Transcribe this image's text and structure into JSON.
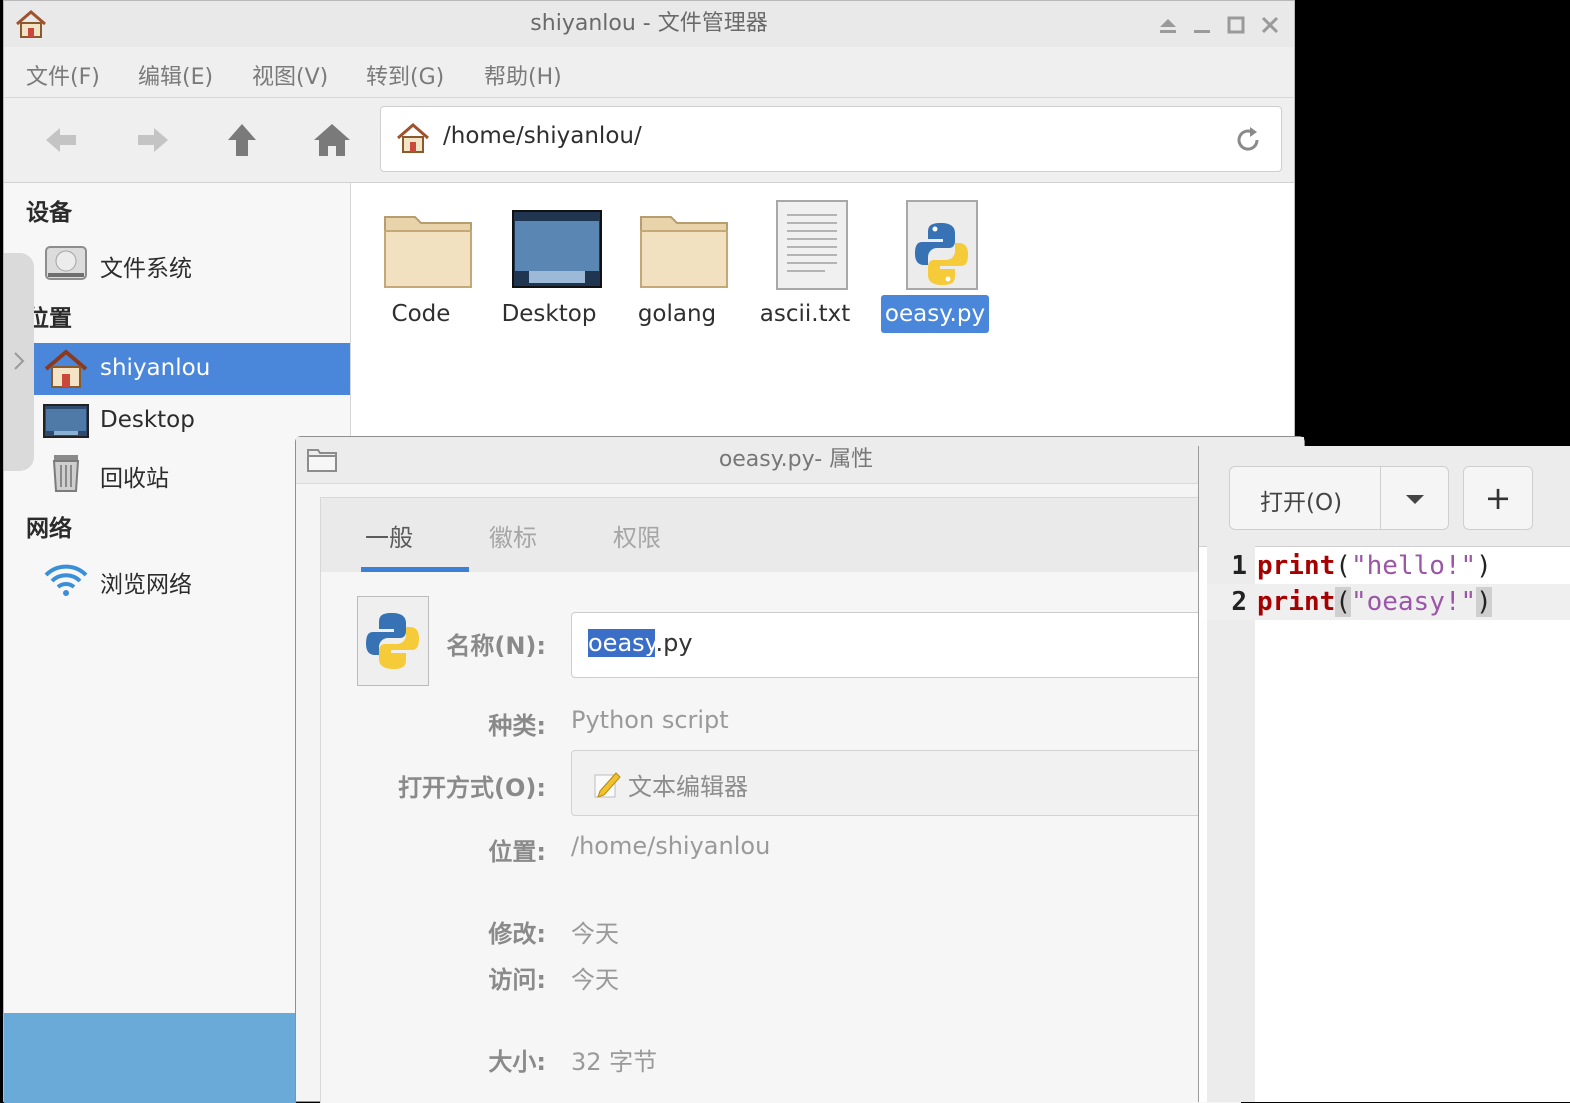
{
  "file_manager": {
    "title": "shiyanlou - 文件管理器",
    "menu": [
      "文件(F)",
      "编辑(E)",
      "视图(V)",
      "转到(G)",
      "帮助(H)"
    ],
    "address": "/home/shiyanlou/",
    "sidebar": {
      "devices_header": "设备",
      "devices": [
        {
          "label": "文件系统",
          "icon": "drive-icon"
        }
      ],
      "places_header": "位置",
      "places": [
        {
          "label": "shiyanlou",
          "icon": "home-icon",
          "selected": true
        },
        {
          "label": "Desktop",
          "icon": "desktop-icon"
        },
        {
          "label": "回收站",
          "icon": "trash-icon"
        }
      ],
      "network_header": "网络",
      "network": [
        {
          "label": "浏览网络",
          "icon": "wifi-icon"
        }
      ]
    },
    "files": [
      {
        "name": "Code",
        "icon": "folder-icon"
      },
      {
        "name": "Desktop",
        "icon": "desktop-folder-icon"
      },
      {
        "name": "golang",
        "icon": "folder-icon"
      },
      {
        "name": "ascii.txt",
        "icon": "text-file-icon"
      },
      {
        "name": "oeasy.py",
        "icon": "python-file-icon",
        "selected": true
      }
    ]
  },
  "properties_dialog": {
    "title": "oeasy.py- 属性",
    "tabs": [
      "一般",
      "徽标",
      "权限"
    ],
    "active_tab": "一般",
    "name_label": "名称(N):",
    "name_selected_part": "oeasy",
    "name_rest": ".py",
    "kind_label": "种类:",
    "kind_value": "Python script",
    "open_with_label": "打开方式(O):",
    "open_with_value": "文本编辑器",
    "location_label": "位置:",
    "location_value": "/home/shiyanlou",
    "modified_label": "修改:",
    "modified_value": "今天",
    "accessed_label": "访问:",
    "accessed_value": "今天",
    "size_label": "大小:",
    "size_value": "32 字节"
  },
  "editor": {
    "open_button": "打开(O)",
    "new_button": "+",
    "lines": [
      {
        "num": "1",
        "keyword": "print",
        "open": "(",
        "string": "\"hello!\"",
        "close": ")"
      },
      {
        "num": "2",
        "keyword": "print",
        "open": "(",
        "string": "\"oeasy!\"",
        "close": ")"
      }
    ]
  },
  "colors": {
    "selection": "#4a86d9",
    "keyword": "#a60000",
    "string": "#9c56a8",
    "tab_underline": "#3b7fd6"
  }
}
